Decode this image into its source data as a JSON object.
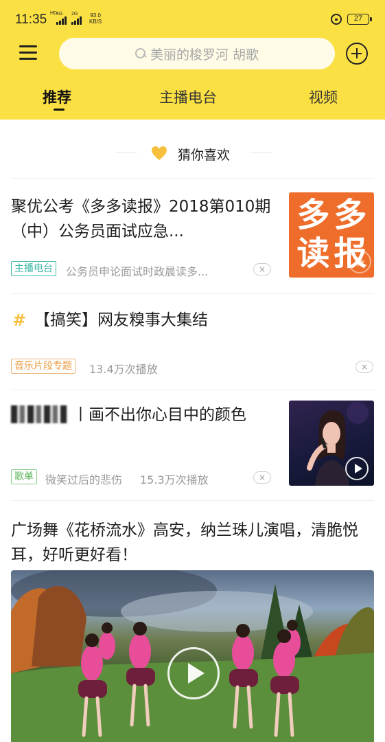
{
  "status_bar": {
    "time": "11:35",
    "sim1_tag": "4G",
    "sim1_sub": "HD",
    "sim2_tag": "2G",
    "speed_value": "93.0",
    "speed_unit": "KB/S",
    "battery": "27"
  },
  "header": {
    "search_placeholder": "美丽的梭罗河  胡歌",
    "tabs": [
      {
        "label": "推荐",
        "active": true
      },
      {
        "label": "主播电台",
        "active": false
      },
      {
        "label": "视频",
        "active": false
      }
    ]
  },
  "colors": {
    "header_bg": "#fbe044",
    "accent": "#f6c03d",
    "badge_radio": "#3cb6a4",
    "badge_music": "#e89a3c",
    "badge_playlist": "#5ab55a"
  },
  "feed": {
    "section_label": "猜你喜欢",
    "items": [
      {
        "title": "聚优公考《多多读报》2018第010期（中）公务员面试应急...",
        "badge": "主播电台",
        "meta": "公务员申论面试时政晨读多...",
        "thumb_text": "多多读报",
        "dismiss": "×"
      },
      {
        "title": "【搞笑】网友糗事大集结",
        "badge": "音乐片段专题",
        "meta": "13.4万次播放",
        "dismiss": "×"
      },
      {
        "title": "丨画不出你心目中的颜色",
        "badge": "歌单",
        "meta_sub": "微笑过后的悲伤",
        "meta": "15.3万次播放",
        "dismiss": "×"
      },
      {
        "title": "广场舞《花桥流水》高安，纳兰珠儿演唱，清脆悦耳，好听更好看！"
      }
    ]
  }
}
